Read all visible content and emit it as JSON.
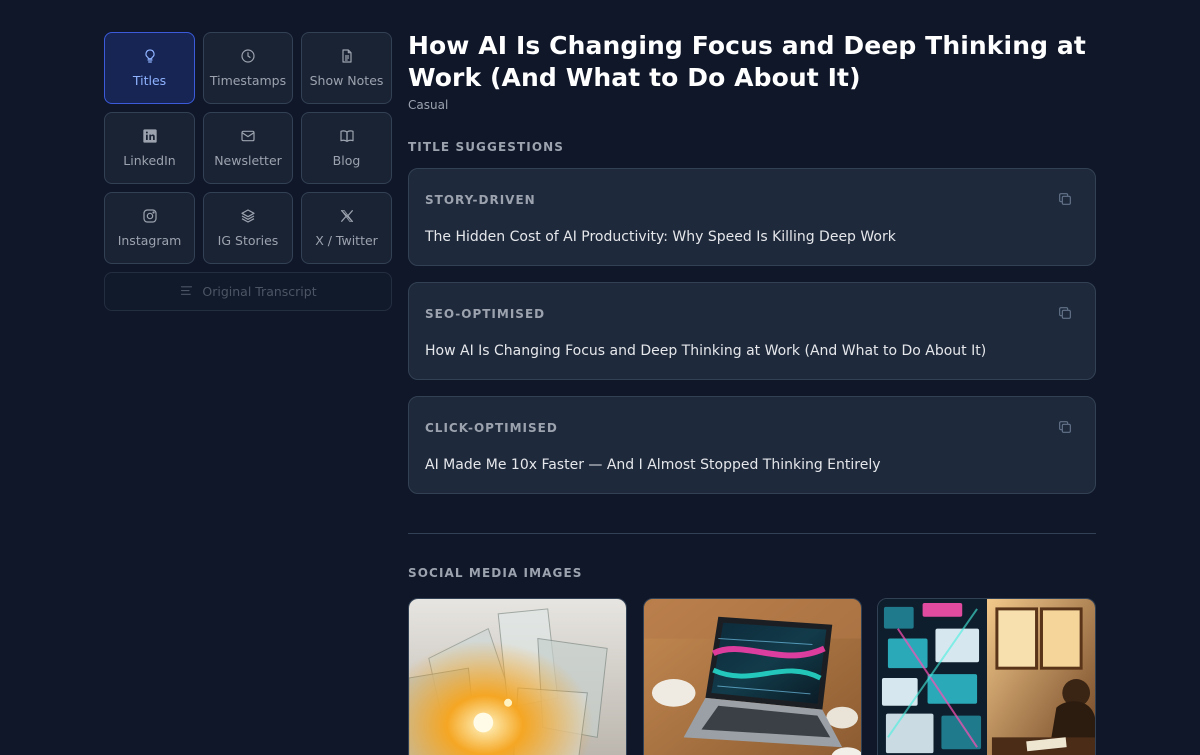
{
  "sidebar": {
    "items": [
      {
        "label": "Titles",
        "icon": "lightbulb-icon",
        "active": true
      },
      {
        "label": "Timestamps",
        "icon": "clock-icon",
        "active": false
      },
      {
        "label": "Show Notes",
        "icon": "document-icon",
        "active": false
      },
      {
        "label": "LinkedIn",
        "icon": "linkedin-icon",
        "active": false
      },
      {
        "label": "Newsletter",
        "icon": "mail-icon",
        "active": false
      },
      {
        "label": "Blog",
        "icon": "book-icon",
        "active": false
      },
      {
        "label": "Instagram",
        "icon": "instagram-icon",
        "active": false
      },
      {
        "label": "IG Stories",
        "icon": "layers-icon",
        "active": false
      },
      {
        "label": "X / Twitter",
        "icon": "x-logo-icon",
        "active": false
      }
    ],
    "transcript_label": "Original Transcript"
  },
  "main": {
    "title": "How AI Is Changing Focus and Deep Thinking at Work (And What to Do About It)",
    "tone": "Casual",
    "titles_heading": "TITLE SUGGESTIONS",
    "suggestions": [
      {
        "kind": "STORY-DRIVEN",
        "text": "The Hidden Cost of AI Productivity: Why Speed Is Killing Deep Work"
      },
      {
        "kind": "SEO-OPTIMISED",
        "text": "How AI Is Changing Focus and Deep Thinking at Work (And What to Do About It)"
      },
      {
        "kind": "CLICK-OPTIMISED",
        "text": "AI Made Me 10x Faster — And I Almost Stopped Thinking Entirely"
      }
    ],
    "social_heading": "SOCIAL MEDIA IMAGES"
  },
  "colors": {
    "background": "#0f1729",
    "card": "#1e293b",
    "border": "#334155",
    "accent": "#3b5bdb",
    "accent_text": "#8fb3ff"
  }
}
